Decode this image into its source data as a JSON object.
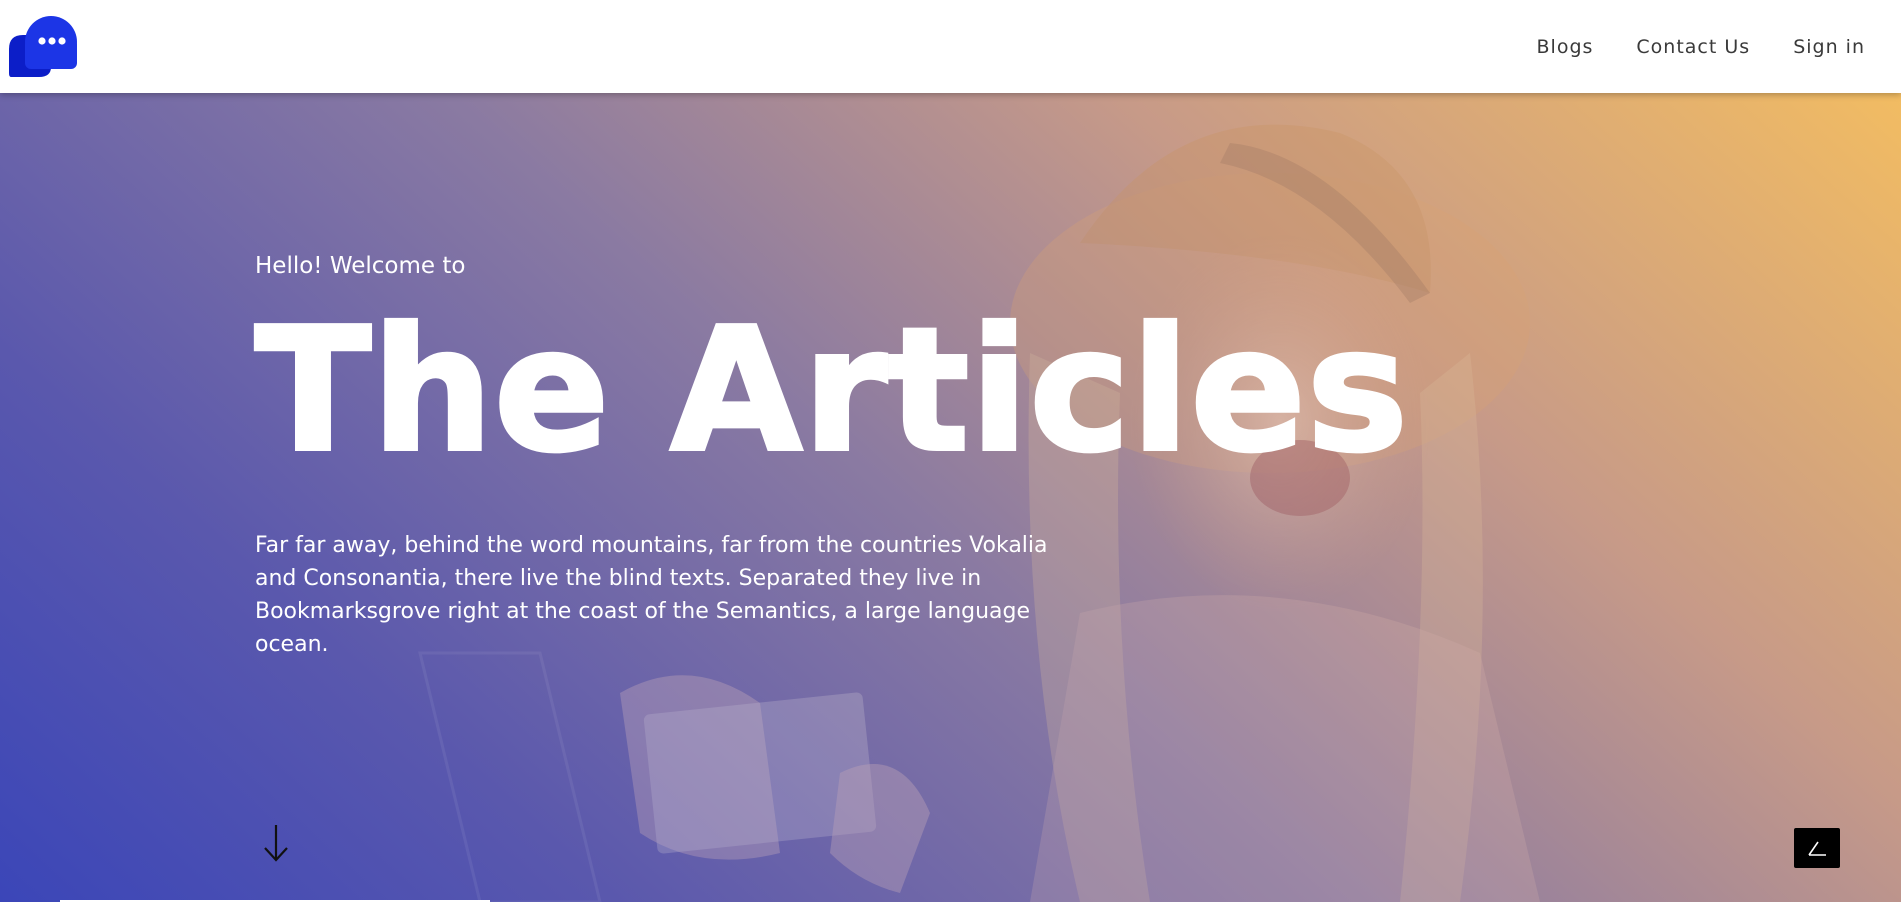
{
  "header": {
    "logo_icon": "chat-bubbles-logo-icon",
    "nav": {
      "blogs": "Blogs",
      "contact": "Contact Us",
      "signin": "Sign in"
    }
  },
  "hero": {
    "subtitle": "Hello! Welcome to",
    "title": "The Articles",
    "description": "Far far away, behind the word mountains, far from the countries Vokalia and Consonantia, there live the blind texts. Separated they live in Bookmarksgrove right at the coast of the Semantics, a large language ocean.",
    "scroll_down_icon": "arrow-down-icon",
    "scroll_up_icon": "arrow-up-icon"
  },
  "colors": {
    "gradient_start": "#3b46b8",
    "gradient_end": "#f2bc62",
    "logo_blue": "#1a2ee0",
    "header_bg": "#ffffff"
  }
}
